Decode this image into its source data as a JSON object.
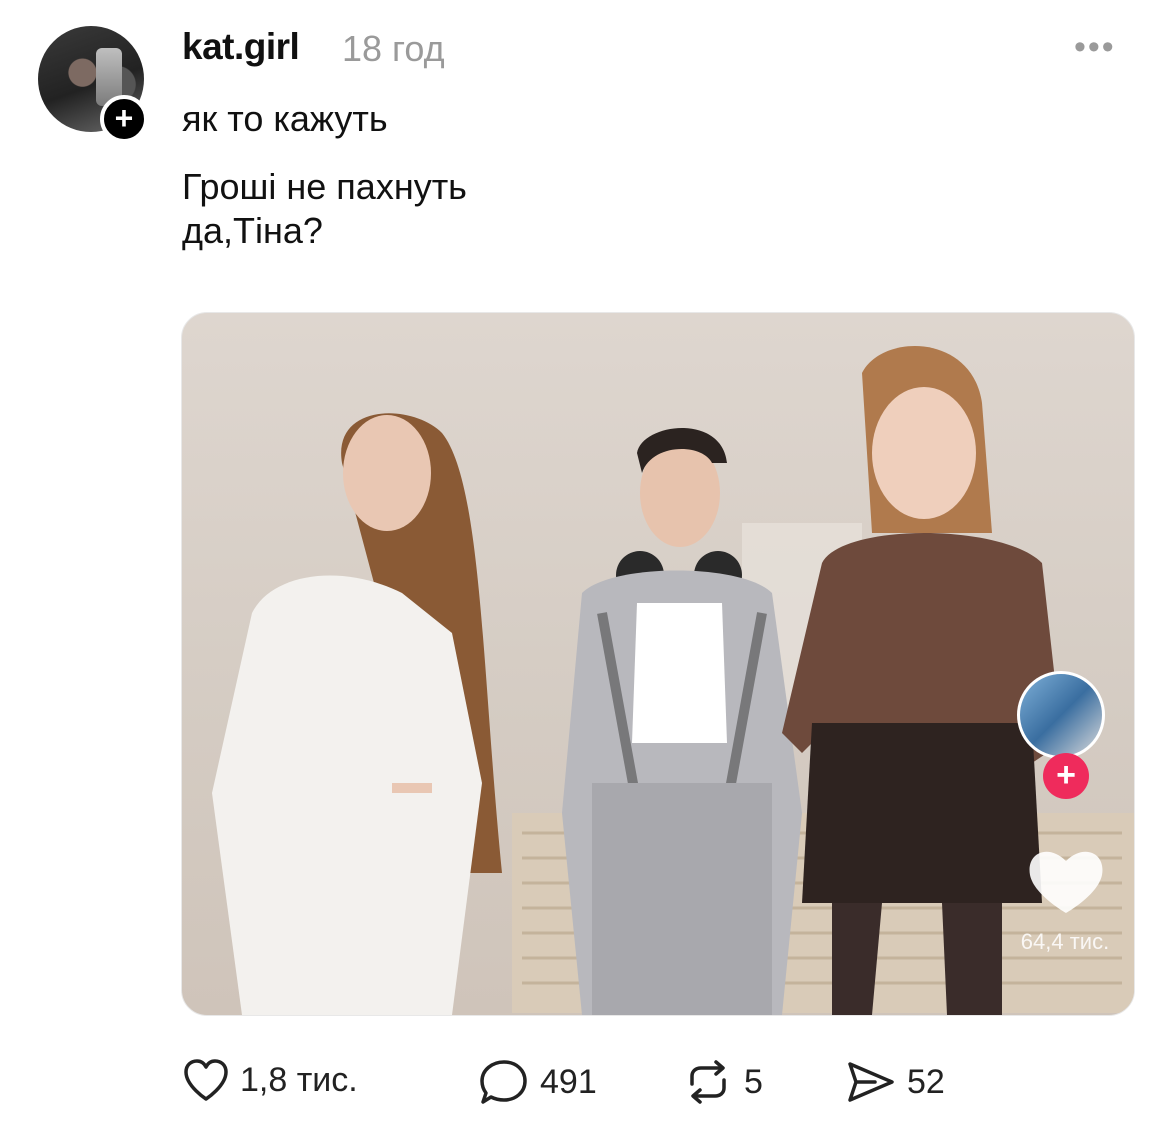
{
  "post": {
    "username": "kat.girl",
    "time": "18 год",
    "follow_icon": "plus-icon",
    "more_icon": "ellipsis-icon",
    "lines": [
      "як то кажуть",
      "Гроші не пахнуть",
      "да,Тіна?"
    ]
  },
  "media": {
    "overlay_likes": "64,4 тис.",
    "overlay_follow_icon": "plus-icon",
    "overlay_like_icon": "heart-icon",
    "accent_color": "#ef2b5c"
  },
  "actions": {
    "likes": "1,8 тис.",
    "comments": "491",
    "reposts": "5",
    "shares": "52",
    "icons": [
      "heart-icon",
      "comment-icon",
      "repost-icon",
      "share-icon"
    ]
  }
}
